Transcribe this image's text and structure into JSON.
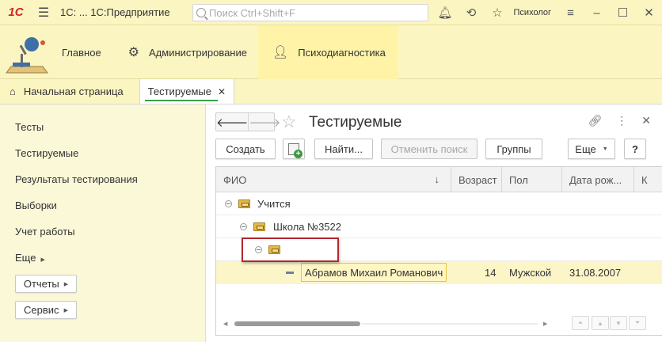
{
  "titlebar": {
    "brand": "1С",
    "title": "1С: ... 1С:Предприятие",
    "search_placeholder": "Поиск Ctrl+Shift+F",
    "user": "Психолог"
  },
  "sections": [
    {
      "label": "Главное",
      "icon": "desk-lamp-icon"
    },
    {
      "label": "Администрирование",
      "icon": "gear-icon"
    },
    {
      "label": "Психодиагностика",
      "icon": "person-icon",
      "active": true
    }
  ],
  "tabs": {
    "home": "Начальная страница",
    "current": "Тестируемые"
  },
  "nav": {
    "items": [
      "Тесты",
      "Тестируемые",
      "Результаты тестирования",
      "Выборки",
      "Учет работы"
    ],
    "more": "Еще",
    "reports": "Отчеты",
    "service": "Сервис"
  },
  "form": {
    "title": "Тестируемые",
    "buttons": {
      "create": "Создать",
      "find": "Найти...",
      "cancel_search": "Отменить поиск",
      "groups": "Группы",
      "more": "Еще",
      "help": "?"
    },
    "columns": [
      "ФИО",
      "Возраст",
      "Пол",
      "Дата рож...",
      "К"
    ],
    "rows": [
      {
        "name": "Учится"
      },
      {
        "name": "Школа №3522"
      },
      {
        "name": ""
      },
      {
        "name": "Абрамов Михаил Романович",
        "age": "14",
        "sex": "Мужской",
        "birth": "31.08.2007"
      }
    ]
  },
  "colors": {
    "accent_bg": "#fbf5c2",
    "selection": "#fbf5c8",
    "highlight_frame": "#b3262e",
    "brand_red": "#d0251f"
  }
}
